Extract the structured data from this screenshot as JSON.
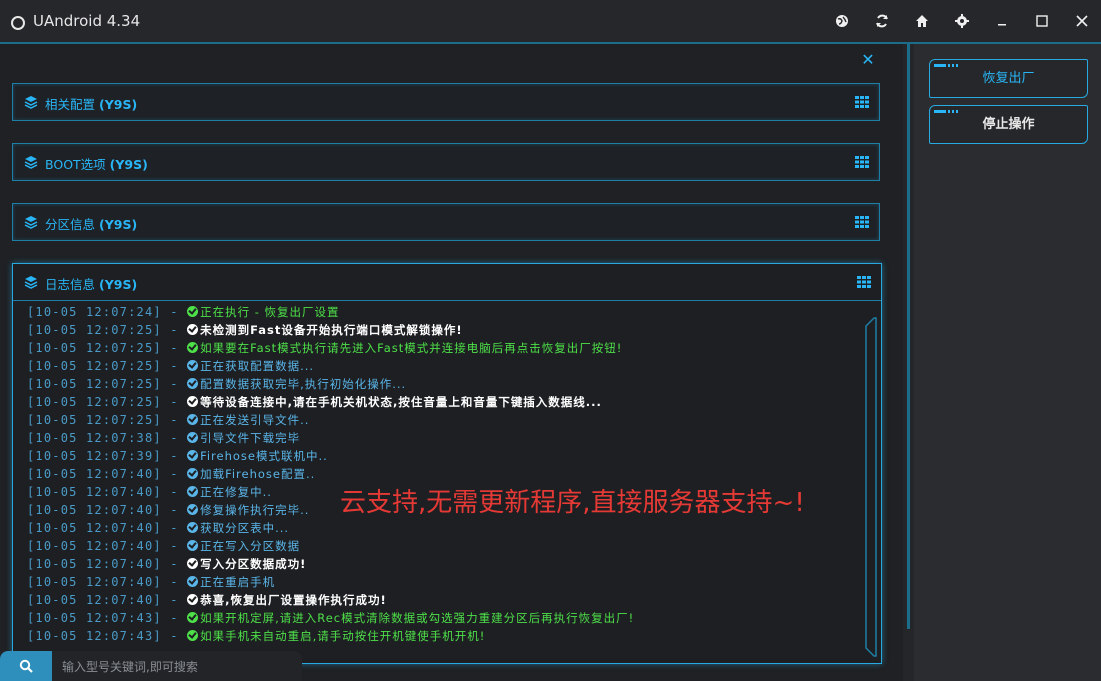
{
  "window": {
    "title": "UAndroid 4.34",
    "toolbar_icons": [
      "globe-icon",
      "refresh-icon",
      "home-icon",
      "gear-icon",
      "minimize-icon",
      "maximize-icon",
      "close-icon"
    ]
  },
  "sections": [
    {
      "label": "相关配置",
      "model": "(Y9S)"
    },
    {
      "label": "BOOT选项",
      "model": "(Y9S)"
    },
    {
      "label": "分区信息",
      "model": "(Y9S)"
    }
  ],
  "log": {
    "label": "日志信息",
    "model": "(Y9S)",
    "lines": [
      {
        "ts": "[10-05 12:07:24] - ",
        "msg": "正在执行 - 恢复出厂设置",
        "color": "green"
      },
      {
        "ts": "[10-05 12:07:25] - ",
        "msg": "未检测到Fast设备开始执行端口模式解锁操作!",
        "color": "white"
      },
      {
        "ts": "[10-05 12:07:25] - ",
        "msg": "如果要在Fast模式执行请先进入Fast模式并连接电脑后再点击恢复出厂按钮!",
        "color": "green"
      },
      {
        "ts": "[10-05 12:07:25] - ",
        "msg": "正在获取配置数据...",
        "color": "blue"
      },
      {
        "ts": "[10-05 12:07:25] - ",
        "msg": "配置数据获取完毕,执行初始化操作...",
        "color": "blue"
      },
      {
        "ts": "[10-05 12:07:25] - ",
        "msg": "等待设备连接中,请在手机关机状态,按住音量上和音量下键插入数据线...",
        "color": "white"
      },
      {
        "ts": "[10-05 12:07:25] - ",
        "msg": "正在发送引导文件..",
        "color": "blue"
      },
      {
        "ts": "[10-05 12:07:38] - ",
        "msg": "引导文件下载完毕",
        "color": "blue"
      },
      {
        "ts": "[10-05 12:07:39] - ",
        "msg": "Firehose模式联机中..",
        "color": "blue"
      },
      {
        "ts": "[10-05 12:07:40] - ",
        "msg": "加载Firehose配置..",
        "color": "blue"
      },
      {
        "ts": "[10-05 12:07:40] - ",
        "msg": "正在修复中..",
        "color": "blue"
      },
      {
        "ts": "[10-05 12:07:40] - ",
        "msg": "修复操作执行完毕..",
        "color": "blue"
      },
      {
        "ts": "[10-05 12:07:40] - ",
        "msg": "获取分区表中...",
        "color": "blue"
      },
      {
        "ts": "[10-05 12:07:40] - ",
        "msg": "正在写入分区数据",
        "color": "blue"
      },
      {
        "ts": "[10-05 12:07:40] - ",
        "msg": "写入分区数据成功!",
        "color": "white"
      },
      {
        "ts": "[10-05 12:07:40] - ",
        "msg": "正在重启手机",
        "color": "blue"
      },
      {
        "ts": "[10-05 12:07:40] - ",
        "msg": "恭喜,恢复出厂设置操作执行成功!",
        "color": "white"
      },
      {
        "ts": "[10-05 12:07:43] - ",
        "msg": "如果开机定屏,请进入Rec模式清除数据或勾选强力重建分区后再执行恢复出厂!",
        "color": "green"
      },
      {
        "ts": "[10-05 12:07:43] - ",
        "msg": "如果手机未自动重启,请手动按住开机键使手机开机!",
        "color": "green"
      }
    ]
  },
  "overlay_text": "云支持,无需更新程序,直接服务器支持~!",
  "right_panel": {
    "restore_label": "恢复出厂",
    "stop_label": "停止操作"
  },
  "search": {
    "placeholder": "输入型号关键词,即可搜索"
  },
  "colors": {
    "accent": "#29b6f6",
    "log_green": "#4ee049",
    "log_blue": "#5ab5e8",
    "overlay_red": "#e53935"
  }
}
